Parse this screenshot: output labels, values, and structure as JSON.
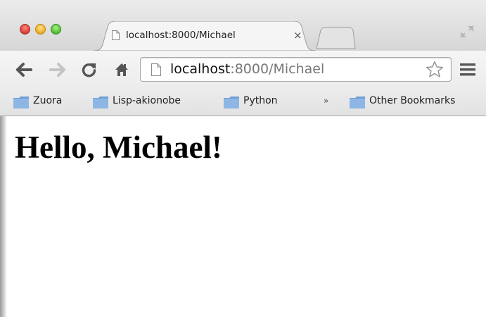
{
  "window": {
    "controls": [
      "close",
      "minimize",
      "zoom"
    ],
    "colors": {
      "close": "#e0443e",
      "minimize": "#f2b32e",
      "zoom": "#5cc33a"
    }
  },
  "tabs": [
    {
      "title": "localhost:8000/Michael",
      "icon": "page-icon",
      "close_label": "×",
      "active": true
    }
  ],
  "toolbar": {
    "back_icon": "back-arrow-icon",
    "forward_icon": "forward-arrow-icon",
    "reload_icon": "reload-icon",
    "home_icon": "home-icon",
    "menu_icon": "hamburger-menu-icon"
  },
  "omnibox": {
    "host": "localhost",
    "rest": ":8000/Michael",
    "star_icon": "bookmark-star-icon"
  },
  "bookmarks": {
    "items": [
      {
        "label": "Zuora",
        "icon": "folder-icon"
      },
      {
        "label": "Lisp-akionobe",
        "icon": "folder-icon"
      },
      {
        "label": "Python",
        "icon": "folder-icon"
      }
    ],
    "overflow_label": "»",
    "other": {
      "label": "Other Bookmarks",
      "icon": "folder-icon"
    }
  },
  "page": {
    "heading": "Hello, Michael!"
  }
}
